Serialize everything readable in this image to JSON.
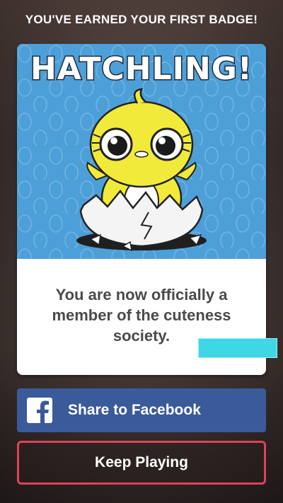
{
  "header": {
    "title": "YOU'VE EARNED YOUR FIRST BADGE!"
  },
  "badge": {
    "name": "HATCHLING!",
    "message_lines": [
      "You are now officially a",
      "member of the cuteness",
      "society."
    ]
  },
  "actions": {
    "facebook_label": "Share to Facebook",
    "keep_playing_label": "Keep Playing"
  },
  "icons": {
    "facebook": "facebook-icon",
    "chick": "chick-illustration"
  },
  "colors": {
    "art_background": "#4d9fd8",
    "facebook_blue": "#3b5a9a",
    "keep_playing_border": "#e0415a",
    "chick_yellow": "#f2ea3a"
  }
}
